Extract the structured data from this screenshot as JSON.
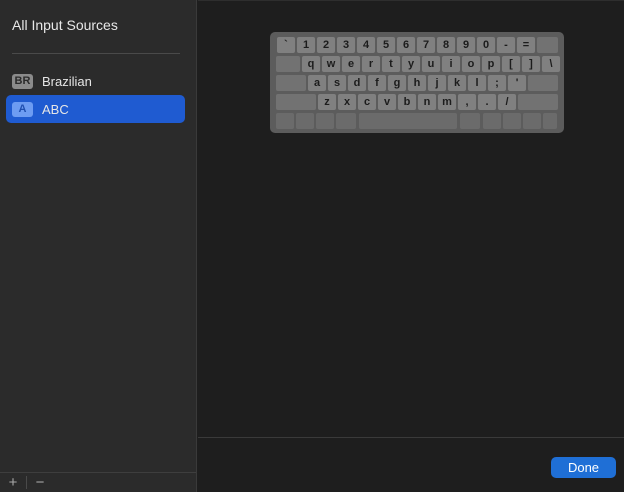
{
  "sidebar": {
    "title": "All Input Sources",
    "items": [
      {
        "badge": "BR",
        "label": "Brazilian",
        "selected": false
      },
      {
        "badge": "A",
        "label": "ABC",
        "selected": true
      }
    ],
    "add_symbol": "+",
    "remove_symbol": "−"
  },
  "keyboard": {
    "row1": [
      "`",
      "1",
      "2",
      "3",
      "4",
      "5",
      "6",
      "7",
      "8",
      "9",
      "0",
      "-",
      "="
    ],
    "row2": [
      "q",
      "w",
      "e",
      "r",
      "t",
      "y",
      "u",
      "i",
      "o",
      "p",
      "[",
      "]",
      "\\"
    ],
    "row3": [
      "a",
      "s",
      "d",
      "f",
      "g",
      "h",
      "j",
      "k",
      "l",
      ";",
      "'"
    ],
    "row4": [
      "z",
      "x",
      "c",
      "v",
      "b",
      "n",
      "m",
      ",",
      ".",
      "/"
    ]
  },
  "footer": {
    "done_label": "Done"
  },
  "colors": {
    "accent": "#1f5bd1",
    "done_button": "#1f6fd6"
  }
}
